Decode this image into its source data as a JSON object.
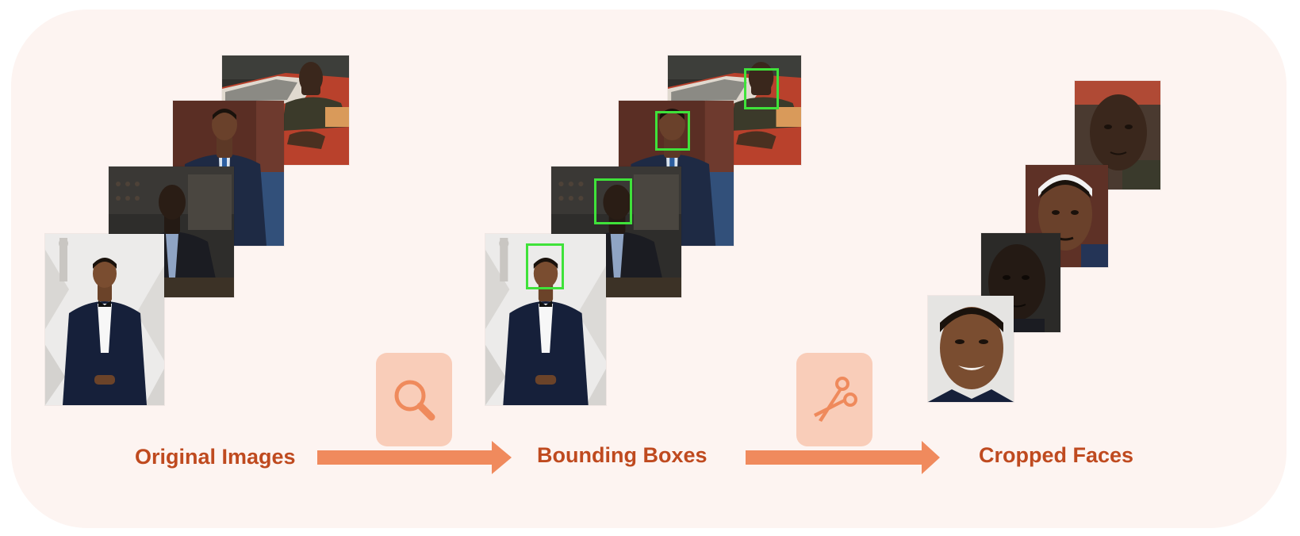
{
  "stages": {
    "original": {
      "label": "Original Images"
    },
    "bounding": {
      "label": "Bounding Boxes"
    },
    "cropped": {
      "label": "Cropped Faces"
    }
  },
  "tools": {
    "detect": {
      "icon": "search-icon"
    },
    "crop": {
      "icon": "scissors-icon"
    }
  },
  "colors": {
    "panel_bg": "#fdf4f1",
    "label": "#bf4a1f",
    "arrow": "#f08a5d",
    "tool_bg": "#f9cdb9",
    "tool_icon": "#ef8a5c",
    "bbox": "#3fe23a"
  }
}
